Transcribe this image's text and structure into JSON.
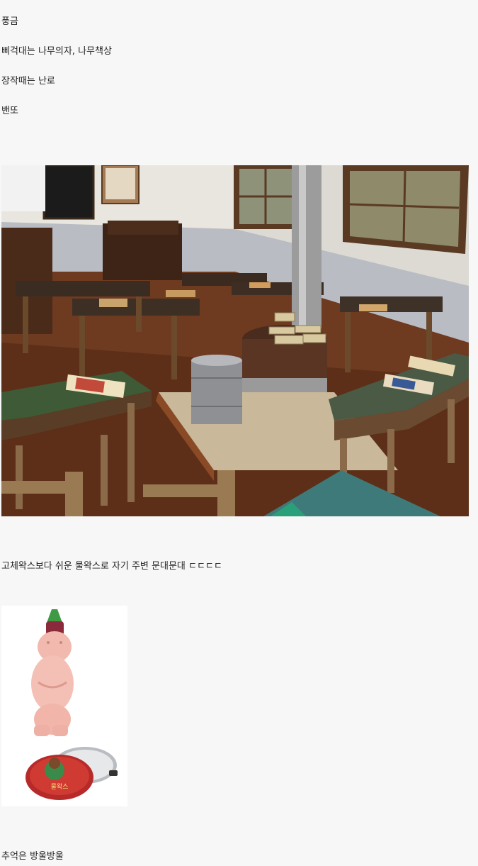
{
  "post": {
    "lines": [
      "풍금",
      "삐걱대는 나무의자, 나무책상",
      "장작때는 난로",
      "밴또",
      "고체왁스보다 쉬운 물왁스로 자기 주변 문대문대 ㄷㄷㄷㄷ",
      "추억은 방울방울"
    ]
  },
  "images": {
    "classroom": {
      "icon": "classroom-photo"
    },
    "wax": {
      "icon": "wax-products-photo",
      "tin_label": "물왁스"
    }
  },
  "colors": {
    "background": "#f7f7f7",
    "text": "#222222"
  }
}
